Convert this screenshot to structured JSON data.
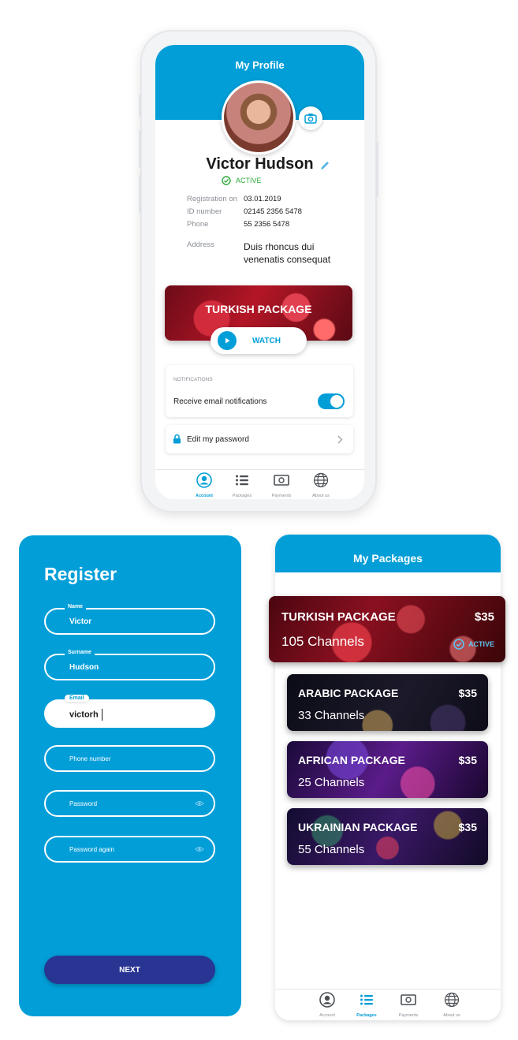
{
  "colors": {
    "accent": "#029ed8",
    "next_button": "#283593",
    "active_green": "#2eaa3b"
  },
  "profile": {
    "title": "My Profile",
    "name": "Victor Hudson",
    "status": "ACTIVE",
    "details": [
      {
        "label": "Registration on",
        "value": "03.01.2019"
      },
      {
        "label": "ID number",
        "value": "02145 2356 5478"
      },
      {
        "label": "Phone",
        "value": "55 2356 5478"
      }
    ],
    "address_label": "Address",
    "address_lines": [
      "Duis rhoncus dui",
      "venenatis consequat"
    ],
    "package_banner": "TURKISH PACKAGE",
    "watch_label": "WATCH",
    "notifications_header": "NOTIFICATIONS",
    "email_notifications_label": "Receive email notifications",
    "email_notifications_on": true,
    "edit_password_label": "Edit my password"
  },
  "tabs": [
    {
      "label": "Account",
      "icon": "account-icon"
    },
    {
      "label": "Packages",
      "icon": "packages-icon"
    },
    {
      "label": "Payments",
      "icon": "payments-icon"
    },
    {
      "label": "About us",
      "icon": "globe-icon"
    }
  ],
  "profile_active_tab": "Account",
  "packages_active_tab": "Packages",
  "register": {
    "title": "Register",
    "fields": [
      {
        "label": "Name",
        "value": "Victor"
      },
      {
        "label": "Surname",
        "value": "Hudson"
      },
      {
        "label": "Email",
        "value": "victorh"
      },
      {
        "placeholder": "Phone number"
      },
      {
        "placeholder": "Password"
      },
      {
        "placeholder": "Password again"
      }
    ],
    "next_label": "NEXT"
  },
  "packages": {
    "title": "My Packages",
    "items": [
      {
        "name": "TURKISH PACKAGE",
        "price": "$35",
        "channels": "105 Channels",
        "status": "ACTIVE"
      },
      {
        "name": "ARABIC PACKAGE",
        "price": "$35",
        "channels": "33 Channels"
      },
      {
        "name": "AFRICAN PACKAGE",
        "price": "$35",
        "channels": "25 Channels"
      },
      {
        "name": "UKRAINIAN PACKAGE",
        "price": "$35",
        "channels": "55 Channels"
      }
    ]
  }
}
